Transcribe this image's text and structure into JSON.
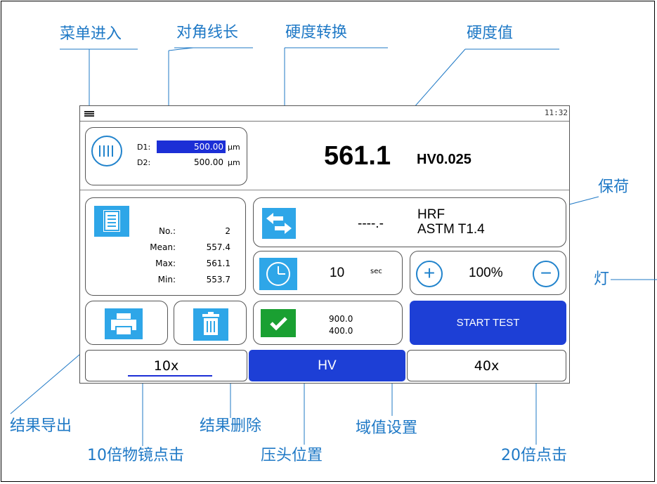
{
  "callouts": {
    "menu_enter": "菜单进入",
    "diagonal_length": "对角线长",
    "hardness_convert": "硬度转换",
    "hardness_value": "硬度值",
    "dwell": "保荷",
    "light": "灯",
    "export_results": "结果导出",
    "delete_results": "结果删除",
    "threshold_setting": "域值设置",
    "objective_10x_click": "10倍物镜点击",
    "indenter_position": "压头位置",
    "objective_20x_click": "20倍点击"
  },
  "screen": {
    "clock": "11:32",
    "measure": {
      "d1_label": "D1:",
      "d1_value": "500.00",
      "d1_unit": "μm",
      "d2_label": "D2:",
      "d2_value": "500.00",
      "d2_unit": "μm"
    },
    "result": {
      "value": "561.1",
      "scale": "HV0.025"
    },
    "stats": {
      "no_label": "No.:",
      "no_value": "2",
      "mean_label": "Mean:",
      "mean_value": "557.4",
      "max_label": "Max:",
      "max_value": "561.1",
      "min_label": "Min:",
      "min_value": "553.7"
    },
    "conversion": {
      "value": "----.-",
      "scale": "HRF",
      "standard": "ASTM T1.4"
    },
    "dwell": {
      "value": "10",
      "unit": "sec"
    },
    "light": {
      "plus": "+",
      "level": "100%",
      "minus": "−"
    },
    "threshold": {
      "upper": "900.0",
      "lower": "400.0"
    },
    "start_test": "START TEST",
    "tabs": {
      "left": "10x",
      "center": "HV",
      "right": "40x"
    }
  },
  "colors": {
    "accent_blue": "#1d3fd6",
    "icon_blue": "#2ea6e8",
    "callout_blue": "#1f79c6",
    "check_green": "#1aa032"
  },
  "icons": [
    "menu-icon",
    "ring-measure-icon",
    "swap-arrows-icon",
    "clock-icon",
    "document-icon",
    "printer-icon",
    "trash-icon",
    "check-icon",
    "plus-icon",
    "minus-icon"
  ]
}
